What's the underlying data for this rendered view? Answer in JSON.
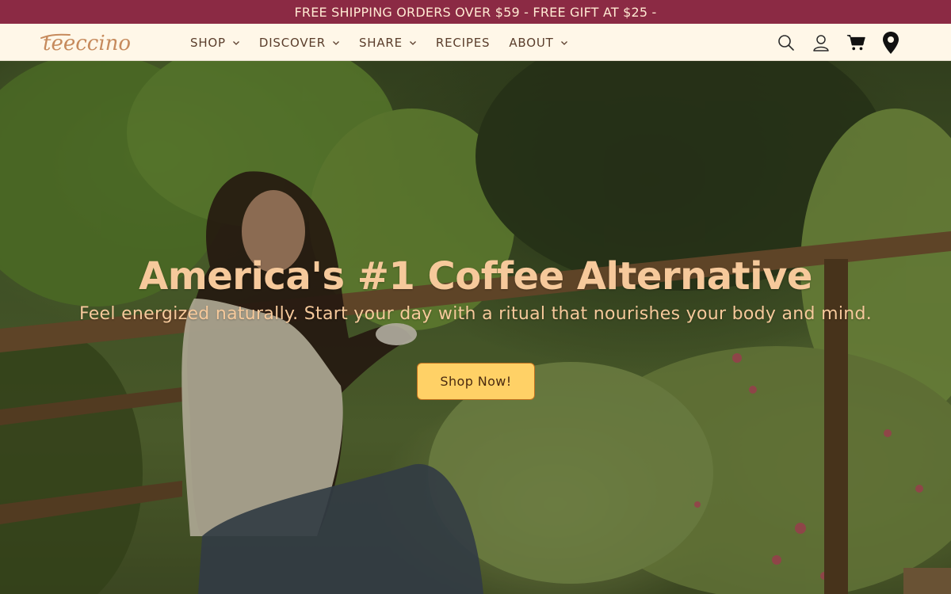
{
  "announcement": {
    "text": "FREE SHIPPING ORDERS OVER $59 - FREE GIFT AT $25 -"
  },
  "header": {
    "logo_text": "teeccino",
    "nav": [
      {
        "label": "SHOP",
        "has_dropdown": true
      },
      {
        "label": "DISCOVER",
        "has_dropdown": true
      },
      {
        "label": "SHARE",
        "has_dropdown": true
      },
      {
        "label": "RECIPES",
        "has_dropdown": false
      },
      {
        "label": "ABOUT",
        "has_dropdown": true
      }
    ],
    "icons": [
      "search-icon",
      "account-icon",
      "cart-icon",
      "store-locator-icon"
    ]
  },
  "hero": {
    "title": "America's #1 Coffee Alternative",
    "subtitle": "Feel energized naturally. Start your day with a ritual that nourishes your body and mind.",
    "cta_label": "Shop Now!"
  },
  "colors": {
    "announcement_bg": "#8b2a44",
    "header_bg": "#fff7e8",
    "accent_text": "#f6c99b",
    "cta_bg": "#ffd166",
    "nav_text": "#5a3d2b"
  }
}
